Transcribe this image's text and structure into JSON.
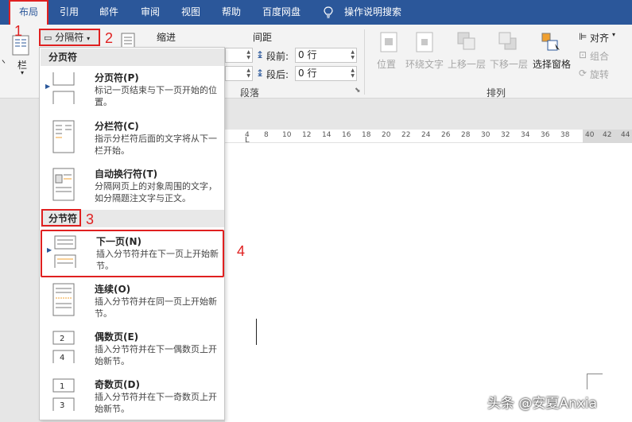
{
  "tabs": [
    "布局",
    "引用",
    "邮件",
    "审阅",
    "视图",
    "帮助",
    "百度网盘",
    "操作说明搜索"
  ],
  "ribbon": {
    "column_label": "栏",
    "break_button": "分隔符",
    "indent_label": "缩进",
    "spacing_label": "间距",
    "before_label": "段前:",
    "before_value": "0 行",
    "after_label": "段后:",
    "after_value": "0 行",
    "paragraph_group": "段落",
    "arrange_group": "排列",
    "arrange_items": [
      "位置",
      "环绕文字",
      "上移一层",
      "下移一层",
      "选择窗格"
    ],
    "align": "对齐",
    "group": "组合",
    "rotate": "旋转"
  },
  "ruler_ticks": [
    "4",
    "6",
    "8",
    "10",
    "12",
    "14",
    "16",
    "18",
    "20",
    "22",
    "24",
    "26",
    "28",
    "30",
    "32",
    "34",
    "36",
    "38",
    "40",
    "42",
    "44"
  ],
  "menu": {
    "section1": "分页符",
    "section2": "分节符",
    "items": [
      {
        "title": "分页符(P)",
        "desc": "标记一页结束与下一页开始的位置。"
      },
      {
        "title": "分栏符(C)",
        "desc": "指示分栏符后面的文字将从下一栏开始。"
      },
      {
        "title": "自动换行符(T)",
        "desc": "分隔网页上的对象周围的文字，如分隔题注文字与正文。"
      },
      {
        "title": "下一页(N)",
        "desc": "插入分节符并在下一页上开始新节。"
      },
      {
        "title": "连续(O)",
        "desc": "插入分节符并在同一页上开始新节。"
      },
      {
        "title": "偶数页(E)",
        "desc": "插入分节符并在下一偶数页上开始新节。"
      },
      {
        "title": "奇数页(D)",
        "desc": "插入分节符并在下一奇数页上开始新节。"
      }
    ]
  },
  "annotations": [
    "1",
    "2",
    "3",
    "4"
  ],
  "watermark": "头条 @安夏Anxia",
  "colors": {
    "accent": "#2b579a",
    "annotation": "#e02020"
  }
}
